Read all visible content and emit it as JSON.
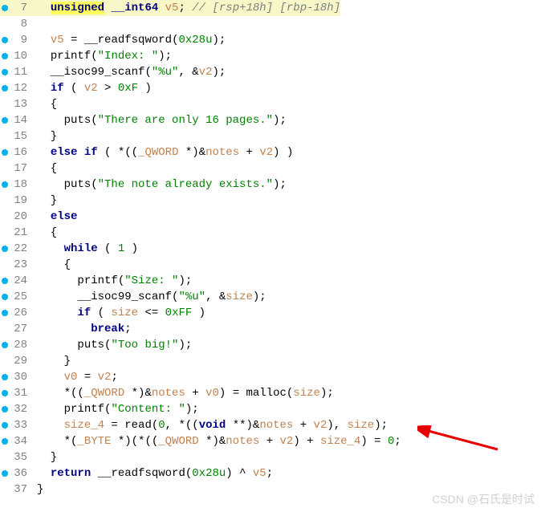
{
  "lines": [
    {
      "n": 7,
      "dot": true,
      "hl": true,
      "segs": [
        [
          "  ",
          ""
        ],
        [
          "unsigned",
          "kw-hl"
        ],
        [
          " ",
          ""
        ],
        [
          "__int64",
          "ty"
        ],
        [
          " ",
          ""
        ],
        [
          "v5",
          "var"
        ],
        [
          "; ",
          ""
        ],
        [
          "// [rsp+18h] [rbp-18h]",
          "cmt"
        ]
      ]
    },
    {
      "n": 8,
      "dot": false,
      "segs": [
        [
          "",
          ""
        ]
      ]
    },
    {
      "n": 9,
      "dot": true,
      "segs": [
        [
          "  ",
          ""
        ],
        [
          "v5",
          "var"
        ],
        [
          " = ",
          ""
        ],
        [
          "__readfsqword",
          "idn"
        ],
        [
          "(",
          ""
        ],
        [
          "0x28u",
          "num"
        ],
        [
          ");",
          ""
        ]
      ]
    },
    {
      "n": 10,
      "dot": true,
      "segs": [
        [
          "  ",
          ""
        ],
        [
          "printf",
          "idn"
        ],
        [
          "(",
          ""
        ],
        [
          "\"Index: \"",
          "str"
        ],
        [
          ");",
          ""
        ]
      ]
    },
    {
      "n": 11,
      "dot": true,
      "segs": [
        [
          "  ",
          ""
        ],
        [
          "__isoc99_scanf",
          "idn"
        ],
        [
          "(",
          ""
        ],
        [
          "\"%u\"",
          "str"
        ],
        [
          ", &",
          ""
        ],
        [
          "v2",
          "var"
        ],
        [
          ");",
          ""
        ]
      ]
    },
    {
      "n": 12,
      "dot": true,
      "segs": [
        [
          "  ",
          ""
        ],
        [
          "if",
          "kw"
        ],
        [
          " ( ",
          ""
        ],
        [
          "v2",
          "var"
        ],
        [
          " > ",
          ""
        ],
        [
          "0xF",
          "num"
        ],
        [
          " )",
          ""
        ]
      ]
    },
    {
      "n": 13,
      "dot": false,
      "segs": [
        [
          "  {",
          ""
        ]
      ]
    },
    {
      "n": 14,
      "dot": true,
      "segs": [
        [
          "    ",
          ""
        ],
        [
          "puts",
          "idn"
        ],
        [
          "(",
          ""
        ],
        [
          "\"There are only 16 pages.\"",
          "str"
        ],
        [
          ");",
          ""
        ]
      ]
    },
    {
      "n": 15,
      "dot": false,
      "segs": [
        [
          "  }",
          ""
        ]
      ]
    },
    {
      "n": 16,
      "dot": true,
      "segs": [
        [
          "  ",
          ""
        ],
        [
          "else",
          "kw"
        ],
        [
          " ",
          ""
        ],
        [
          "if",
          "kw"
        ],
        [
          " ( *((",
          ""
        ],
        [
          "_QWORD",
          "var"
        ],
        [
          " *)&",
          ""
        ],
        [
          "notes",
          "var"
        ],
        [
          " + ",
          ""
        ],
        [
          "v2",
          "var"
        ],
        [
          ") )",
          ""
        ]
      ]
    },
    {
      "n": 17,
      "dot": false,
      "segs": [
        [
          "  {",
          ""
        ]
      ]
    },
    {
      "n": 18,
      "dot": true,
      "segs": [
        [
          "    ",
          ""
        ],
        [
          "puts",
          "idn"
        ],
        [
          "(",
          ""
        ],
        [
          "\"The note already exists.\"",
          "str"
        ],
        [
          ");",
          ""
        ]
      ]
    },
    {
      "n": 19,
      "dot": false,
      "segs": [
        [
          "  }",
          ""
        ]
      ]
    },
    {
      "n": 20,
      "dot": false,
      "segs": [
        [
          "  ",
          ""
        ],
        [
          "else",
          "kw"
        ]
      ]
    },
    {
      "n": 21,
      "dot": false,
      "segs": [
        [
          "  {",
          ""
        ]
      ]
    },
    {
      "n": 22,
      "dot": true,
      "segs": [
        [
          "    ",
          ""
        ],
        [
          "while",
          "kw"
        ],
        [
          " ( ",
          ""
        ],
        [
          "1",
          "num"
        ],
        [
          " )",
          ""
        ]
      ]
    },
    {
      "n": 23,
      "dot": false,
      "segs": [
        [
          "    {",
          ""
        ]
      ]
    },
    {
      "n": 24,
      "dot": true,
      "segs": [
        [
          "      ",
          ""
        ],
        [
          "printf",
          "idn"
        ],
        [
          "(",
          ""
        ],
        [
          "\"Size: \"",
          "str"
        ],
        [
          ");",
          ""
        ]
      ]
    },
    {
      "n": 25,
      "dot": true,
      "segs": [
        [
          "      ",
          ""
        ],
        [
          "__isoc99_scanf",
          "idn"
        ],
        [
          "(",
          ""
        ],
        [
          "\"%u\"",
          "str"
        ],
        [
          ", &",
          ""
        ],
        [
          "size",
          "var"
        ],
        [
          ");",
          ""
        ]
      ]
    },
    {
      "n": 26,
      "dot": true,
      "segs": [
        [
          "      ",
          ""
        ],
        [
          "if",
          "kw"
        ],
        [
          " ( ",
          ""
        ],
        [
          "size",
          "var"
        ],
        [
          " <= ",
          ""
        ],
        [
          "0xFF",
          "num"
        ],
        [
          " )",
          ""
        ]
      ]
    },
    {
      "n": 27,
      "dot": false,
      "segs": [
        [
          "        ",
          ""
        ],
        [
          "break",
          "kw"
        ],
        [
          ";",
          ""
        ]
      ]
    },
    {
      "n": 28,
      "dot": true,
      "segs": [
        [
          "      ",
          ""
        ],
        [
          "puts",
          "idn"
        ],
        [
          "(",
          ""
        ],
        [
          "\"Too big!\"",
          "str"
        ],
        [
          ");",
          ""
        ]
      ]
    },
    {
      "n": 29,
      "dot": false,
      "segs": [
        [
          "    }",
          ""
        ]
      ]
    },
    {
      "n": 30,
      "dot": true,
      "segs": [
        [
          "    ",
          ""
        ],
        [
          "v0",
          "var"
        ],
        [
          " = ",
          ""
        ],
        [
          "v2",
          "var"
        ],
        [
          ";",
          ""
        ]
      ]
    },
    {
      "n": 31,
      "dot": true,
      "segs": [
        [
          "    *((",
          ""
        ],
        [
          "_QWORD",
          "var"
        ],
        [
          " *)&",
          ""
        ],
        [
          "notes",
          "var"
        ],
        [
          " + ",
          ""
        ],
        [
          "v0",
          "var"
        ],
        [
          ") = ",
          ""
        ],
        [
          "malloc",
          "idn"
        ],
        [
          "(",
          ""
        ],
        [
          "size",
          "var"
        ],
        [
          ");",
          ""
        ]
      ]
    },
    {
      "n": 32,
      "dot": true,
      "segs": [
        [
          "    ",
          ""
        ],
        [
          "printf",
          "idn"
        ],
        [
          "(",
          ""
        ],
        [
          "\"Content: \"",
          "str"
        ],
        [
          ");",
          ""
        ]
      ]
    },
    {
      "n": 33,
      "dot": true,
      "segs": [
        [
          "    ",
          ""
        ],
        [
          "size_4",
          "var"
        ],
        [
          " = ",
          ""
        ],
        [
          "read",
          "idn"
        ],
        [
          "(",
          ""
        ],
        [
          "0",
          "num"
        ],
        [
          ", *((",
          ""
        ],
        [
          "void",
          "kw"
        ],
        [
          " **)&",
          ""
        ],
        [
          "notes",
          "var"
        ],
        [
          " + ",
          ""
        ],
        [
          "v2",
          "var"
        ],
        [
          "), ",
          ""
        ],
        [
          "size",
          "var"
        ],
        [
          ");",
          ""
        ]
      ]
    },
    {
      "n": 34,
      "dot": true,
      "segs": [
        [
          "    *(",
          ""
        ],
        [
          "_BYTE",
          "var"
        ],
        [
          " *)(*((",
          ""
        ],
        [
          "_QWORD",
          "var"
        ],
        [
          " *)&",
          ""
        ],
        [
          "notes",
          "var"
        ],
        [
          " + ",
          ""
        ],
        [
          "v2",
          "var"
        ],
        [
          ") + ",
          ""
        ],
        [
          "size_4",
          "var"
        ],
        [
          ") = ",
          ""
        ],
        [
          "0",
          "num"
        ],
        [
          ";",
          ""
        ]
      ]
    },
    {
      "n": 35,
      "dot": false,
      "segs": [
        [
          "  }",
          ""
        ]
      ]
    },
    {
      "n": 36,
      "dot": true,
      "segs": [
        [
          "  ",
          ""
        ],
        [
          "return",
          "kw"
        ],
        [
          " ",
          ""
        ],
        [
          "__readfsqword",
          "idn"
        ],
        [
          "(",
          ""
        ],
        [
          "0x28u",
          "num"
        ],
        [
          ") ^ ",
          ""
        ],
        [
          "v5",
          "var"
        ],
        [
          ";",
          ""
        ]
      ]
    },
    {
      "n": 37,
      "dot": false,
      "segs": [
        [
          "}",
          ""
        ]
      ]
    }
  ],
  "watermark": "CSDN @石氏是时试"
}
